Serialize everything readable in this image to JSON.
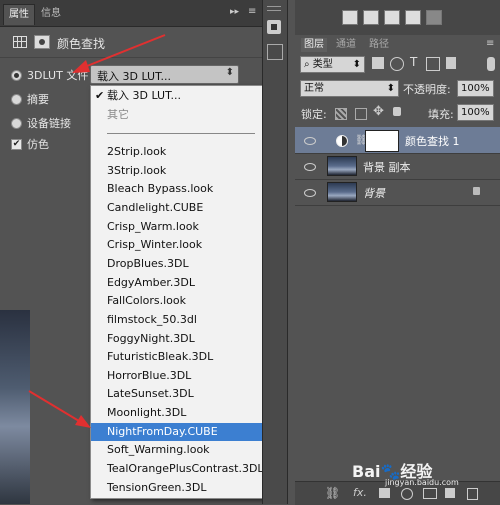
{
  "properties_panel": {
    "tabs": [
      "属性",
      "信息"
    ],
    "header_title": "颜色查找",
    "options": [
      {
        "label": "3DLUT 文件",
        "checked": true
      },
      {
        "label": "摘要",
        "checked": false
      },
      {
        "label": "设备链接",
        "checked": false
      },
      {
        "label": "仿色",
        "checked": true
      }
    ],
    "select_value": "载入 3D LUT...",
    "select_arrow": "⬍"
  },
  "dropdown": {
    "top_items": [
      {
        "label": "载入 3D LUT...",
        "checkmark": "✔"
      },
      {
        "label": "其它"
      }
    ],
    "items": [
      "2Strip.look",
      "3Strip.look",
      "Bleach Bypass.look",
      "Candlelight.CUBE",
      "Crisp_Warm.look",
      "Crisp_Winter.look",
      "DropBlues.3DL",
      "EdgyAmber.3DL",
      "FallColors.look",
      "filmstock_50.3dl",
      "FoggyNight.3DL",
      "FuturisticBleak.3DL",
      "HorrorBlue.3DL",
      "LateSunset.3DL",
      "Moonlight.3DL",
      "NightFromDay.CUBE",
      "Soft_Warming.look",
      "TealOrangePlusContrast.3DL",
      "TensionGreen.3DL"
    ],
    "selected": "NightFromDay.CUBE"
  },
  "layers_panel": {
    "tabs": [
      "图层",
      "通道",
      "路径"
    ],
    "filter_kind": "类型",
    "blend_mode": "正常",
    "opacity_label": "不透明度:",
    "opacity_value": "100%",
    "lock_label": "锁定:",
    "fill_label": "填充:",
    "fill_value": "100%",
    "layers": [
      {
        "name": "颜色查找 1"
      },
      {
        "name": "背景 副本"
      },
      {
        "name": "背景"
      }
    ],
    "bottom_fx": "fx."
  },
  "watermark": {
    "brand_left": "Bai",
    "brand_right": "经验",
    "url": "jingyan.baidu.com"
  },
  "colors": {
    "selection": "#3c7fd1",
    "panel": "#535353",
    "arrow": "#e03030"
  }
}
